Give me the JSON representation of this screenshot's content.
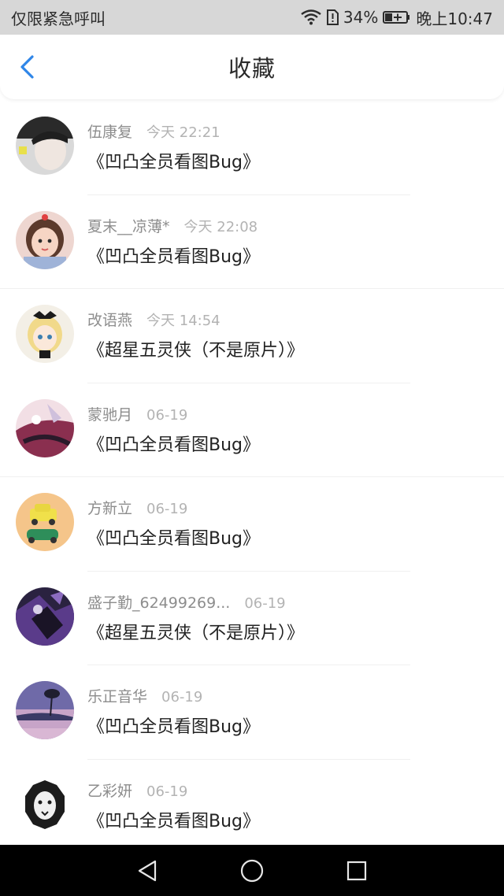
{
  "status_bar": {
    "carrier": "仅限紧急呼叫",
    "battery_percent": "34%",
    "time": "晚上10:47"
  },
  "header": {
    "title": "收藏"
  },
  "items": [
    {
      "username": "伍康复",
      "time": "今天 22:21",
      "title": "《凹凸全员看图Bug》"
    },
    {
      "username": "夏末__凉薄*",
      "time": "今天 22:08",
      "title": "《凹凸全员看图Bug》"
    },
    {
      "username": "改语燕",
      "time": "今天 14:54",
      "title": "《超星五灵侠（不是原片）》"
    },
    {
      "username": "蒙驰月",
      "time": "06-19",
      "title": "《凹凸全员看图Bug》"
    },
    {
      "username": "方新立",
      "time": "06-19",
      "title": "《凹凸全员看图Bug》"
    },
    {
      "username": "盛子勤_62499269...",
      "time": "06-19",
      "title": "《超星五灵侠（不是原片）》"
    },
    {
      "username": "乐正音华",
      "time": "06-19",
      "title": "《凹凸全员看图Bug》"
    },
    {
      "username": "乙彩妍",
      "time": "06-19",
      "title": "《凹凸全员看图Bug》"
    }
  ],
  "colors": {
    "accent": "#2f86e8",
    "status_bar_bg": "#d7d7d7",
    "system_nav_bg": "#000000"
  }
}
